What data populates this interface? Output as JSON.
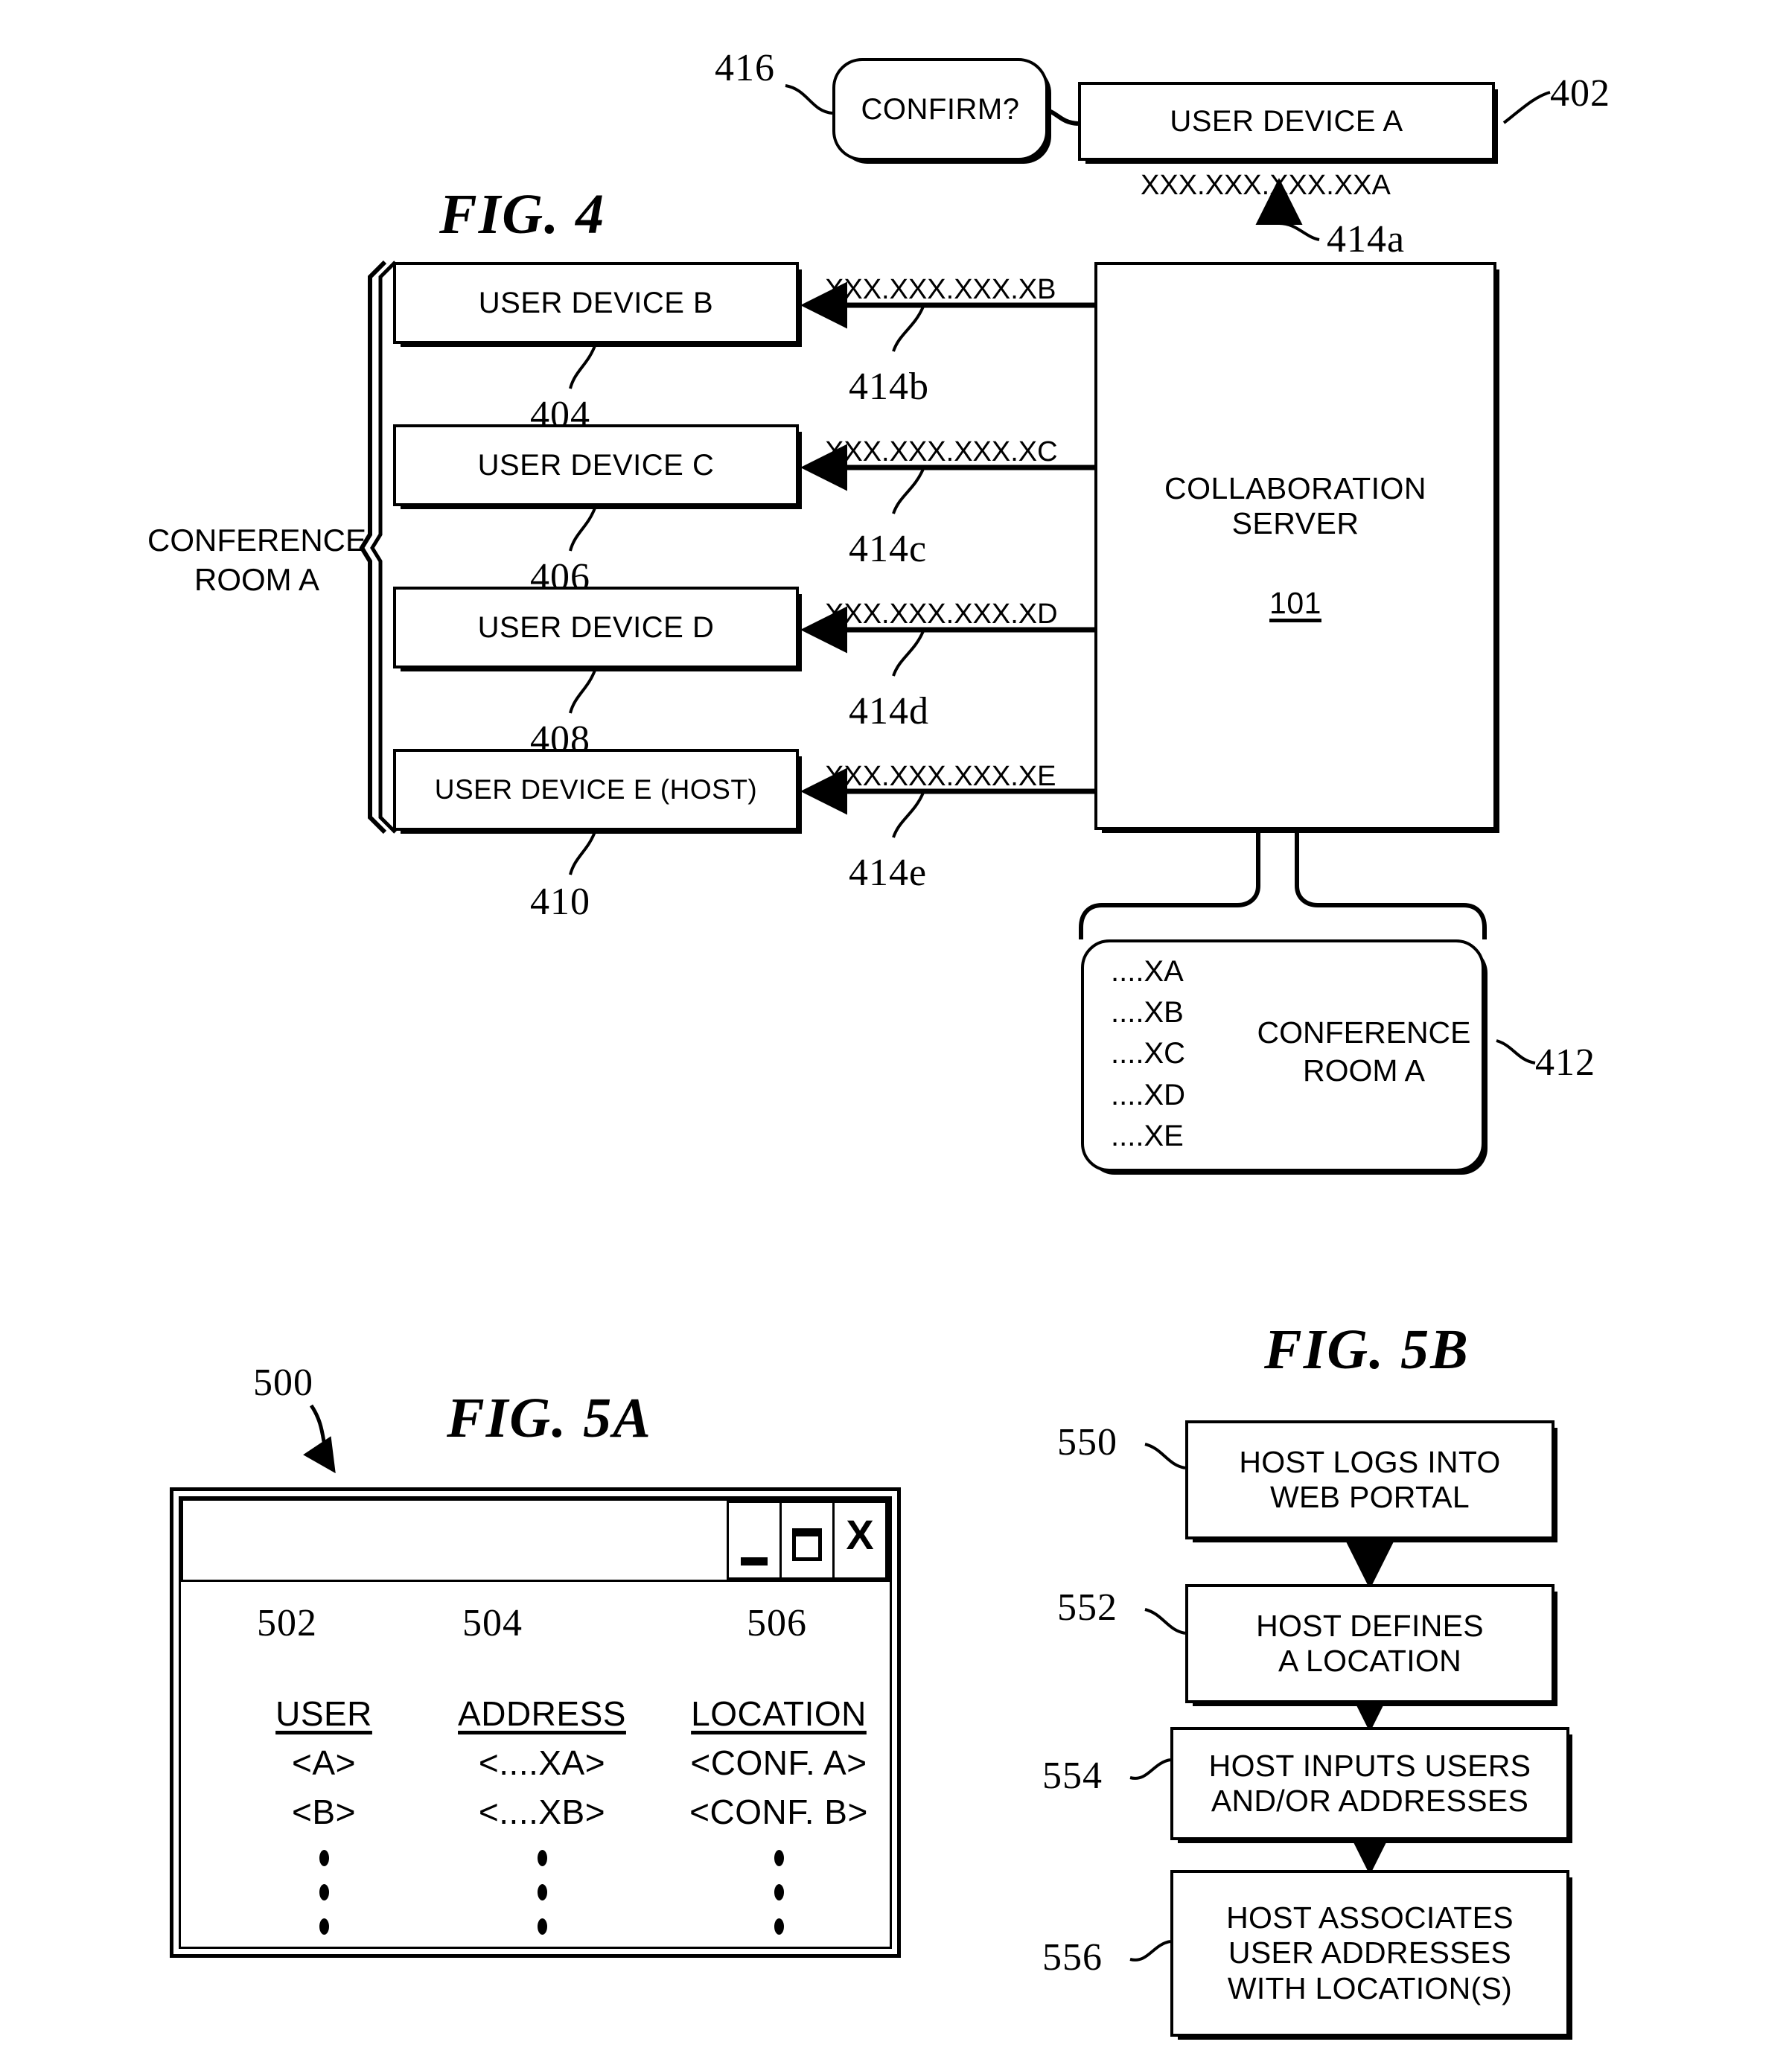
{
  "figures": {
    "fig4": {
      "title": "FIG. 4",
      "confirm_balloon": {
        "label": "CONFIRM?",
        "ref": "416"
      },
      "user_device_a": {
        "label": "USER DEVICE A",
        "ref": "402",
        "address": "XXX.XXX.XXX.XXA",
        "arrow_ref": "414a"
      },
      "conference_room_label": "CONFERENCE\nROOM A",
      "conference_room_line1": "CONFERENCE",
      "conference_room_line2": "ROOM A",
      "devices": [
        {
          "label": "USER DEVICE B",
          "ref": "404",
          "address": "XXX.XXX.XXX.XB",
          "arrow_ref": "414b"
        },
        {
          "label": "USER DEVICE C",
          "ref": "406",
          "address": "XXX.XXX.XXX.XC",
          "arrow_ref": "414c"
        },
        {
          "label": "USER DEVICE D",
          "ref": "408",
          "address": "XXX.XXX.XXX.XD",
          "arrow_ref": "414d"
        },
        {
          "label": "USER DEVICE E (HOST)",
          "ref": "410",
          "address": "XXX.XXX.XXX.XE",
          "arrow_ref": "414e"
        }
      ],
      "server": {
        "line1": "COLLABORATION",
        "line2": "SERVER",
        "ref": "101"
      },
      "room_record": {
        "ref": "412",
        "addresses": [
          "....XA",
          "....XB",
          "....XC",
          "....XD",
          "....XE"
        ],
        "name_line1": "CONFERENCE",
        "name_line2": "ROOM A"
      }
    },
    "fig5a": {
      "title": "FIG. 5A",
      "window_ref": "500",
      "window_buttons": [
        {
          "name": "minimize",
          "glyph": "_"
        },
        {
          "name": "maximize",
          "glyph": "□"
        },
        {
          "name": "close",
          "glyph": "X"
        }
      ],
      "table": {
        "column_refs": [
          "502",
          "504",
          "506"
        ],
        "headers": [
          "USER",
          "ADDRESS",
          "LOCATION"
        ],
        "rows": [
          [
            "<A>",
            "<....XA>",
            "<CONF. A>"
          ],
          [
            "<B>",
            "<....XB>",
            "<CONF. B>"
          ]
        ],
        "ellipsis_dots": 3
      }
    },
    "fig5b": {
      "title": "FIG. 5B",
      "steps": [
        {
          "ref": "550",
          "line1": "HOST LOGS INTO",
          "line2": "WEB PORTAL",
          "line3": ""
        },
        {
          "ref": "552",
          "line1": "HOST DEFINES",
          "line2": "A LOCATION",
          "line3": ""
        },
        {
          "ref": "554",
          "line1": "HOST INPUTS USERS",
          "line2": "AND/OR ADDRESSES",
          "line3": ""
        },
        {
          "ref": "556",
          "line1": "HOST ASSOCIATES",
          "line2": "USER ADDRESSES",
          "line3": "WITH LOCATION(S)"
        }
      ]
    }
  },
  "colors": {
    "ink": "#000000",
    "paper": "#ffffff"
  }
}
